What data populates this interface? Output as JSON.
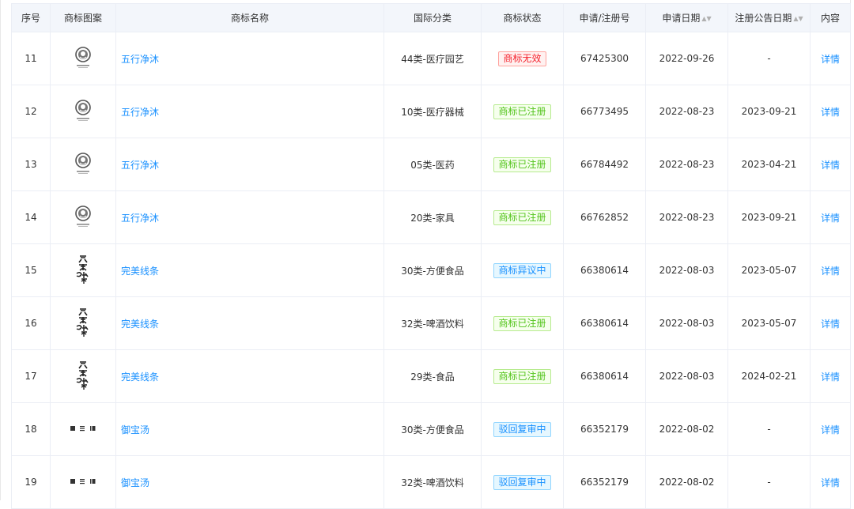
{
  "headers": {
    "seq": "序号",
    "image": "商标图案",
    "name": "商标名称",
    "class": "国际分类",
    "status": "商标状态",
    "reg_no": "申请/注册号",
    "apply_date": "申请日期",
    "publish_date": "注册公告日期",
    "content": "内容"
  },
  "colors": {
    "link": "#1890ff",
    "invalid_text": "#f5222d",
    "invalid_bg": "#fff1f0",
    "invalid_border": "#ffa39e",
    "registered_text": "#52c41a",
    "registered_bg": "#f6ffed",
    "registered_border": "#b7eb8f",
    "pending_text": "#1890ff",
    "pending_bg": "#e6f7ff",
    "pending_border": "#91d5ff"
  },
  "rows": [
    {
      "seq": "11",
      "logo": "wuxing",
      "logo_text": "五行净沐",
      "name": "五行净沐",
      "class": "44类-医疗园艺",
      "status": "商标无效",
      "status_type": "invalid",
      "reg_no": "67425300",
      "apply_date": "2022-09-26",
      "publish_date": "-",
      "content": "详情"
    },
    {
      "seq": "12",
      "logo": "wuxing",
      "logo_text": "五行净沐",
      "name": "五行净沐",
      "class": "10类-医疗器械",
      "status": "商标已注册",
      "status_type": "registered",
      "reg_no": "66773495",
      "apply_date": "2022-08-23",
      "publish_date": "2023-09-21",
      "content": "详情"
    },
    {
      "seq": "13",
      "logo": "wuxing",
      "logo_text": "五行净沐",
      "name": "五行净沐",
      "class": "05类-医药",
      "status": "商标已注册",
      "status_type": "registered",
      "reg_no": "66784492",
      "apply_date": "2022-08-23",
      "publish_date": "2023-04-21",
      "content": "详情"
    },
    {
      "seq": "14",
      "logo": "wuxing",
      "logo_text": "五行净沐",
      "name": "五行净沐",
      "class": "20类-家具",
      "status": "商标已注册",
      "status_type": "registered",
      "reg_no": "66762852",
      "apply_date": "2022-08-23",
      "publish_date": "2023-09-21",
      "content": "详情"
    },
    {
      "seq": "15",
      "logo": "wanmei",
      "logo_text": "完美线条",
      "name": "完美线条",
      "class": "30类-方便食品",
      "status": "商标异议中",
      "status_type": "pending",
      "reg_no": "66380614",
      "apply_date": "2022-08-03",
      "publish_date": "2023-05-07",
      "content": "详情"
    },
    {
      "seq": "16",
      "logo": "wanmei",
      "logo_text": "完美线条",
      "name": "完美线条",
      "class": "32类-啤酒饮料",
      "status": "商标已注册",
      "status_type": "registered",
      "reg_no": "66380614",
      "apply_date": "2022-08-03",
      "publish_date": "2023-05-07",
      "content": "详情"
    },
    {
      "seq": "17",
      "logo": "wanmei",
      "logo_text": "完美线条",
      "name": "完美线条",
      "class": "29类-食品",
      "status": "商标已注册",
      "status_type": "registered",
      "reg_no": "66380614",
      "apply_date": "2022-08-03",
      "publish_date": "2024-02-21",
      "content": "详情"
    },
    {
      "seq": "18",
      "logo": "yubao",
      "logo_text": "御宝汤",
      "name": "御宝汤",
      "class": "30类-方便食品",
      "status": "驳回复审中",
      "status_type": "pending",
      "reg_no": "66352179",
      "apply_date": "2022-08-02",
      "publish_date": "-",
      "content": "详情"
    },
    {
      "seq": "19",
      "logo": "yubao",
      "logo_text": "御宝汤",
      "name": "御宝汤",
      "class": "32类-啤酒饮料",
      "status": "驳回复审中",
      "status_type": "pending",
      "reg_no": "66352179",
      "apply_date": "2022-08-02",
      "publish_date": "-",
      "content": "详情"
    }
  ]
}
